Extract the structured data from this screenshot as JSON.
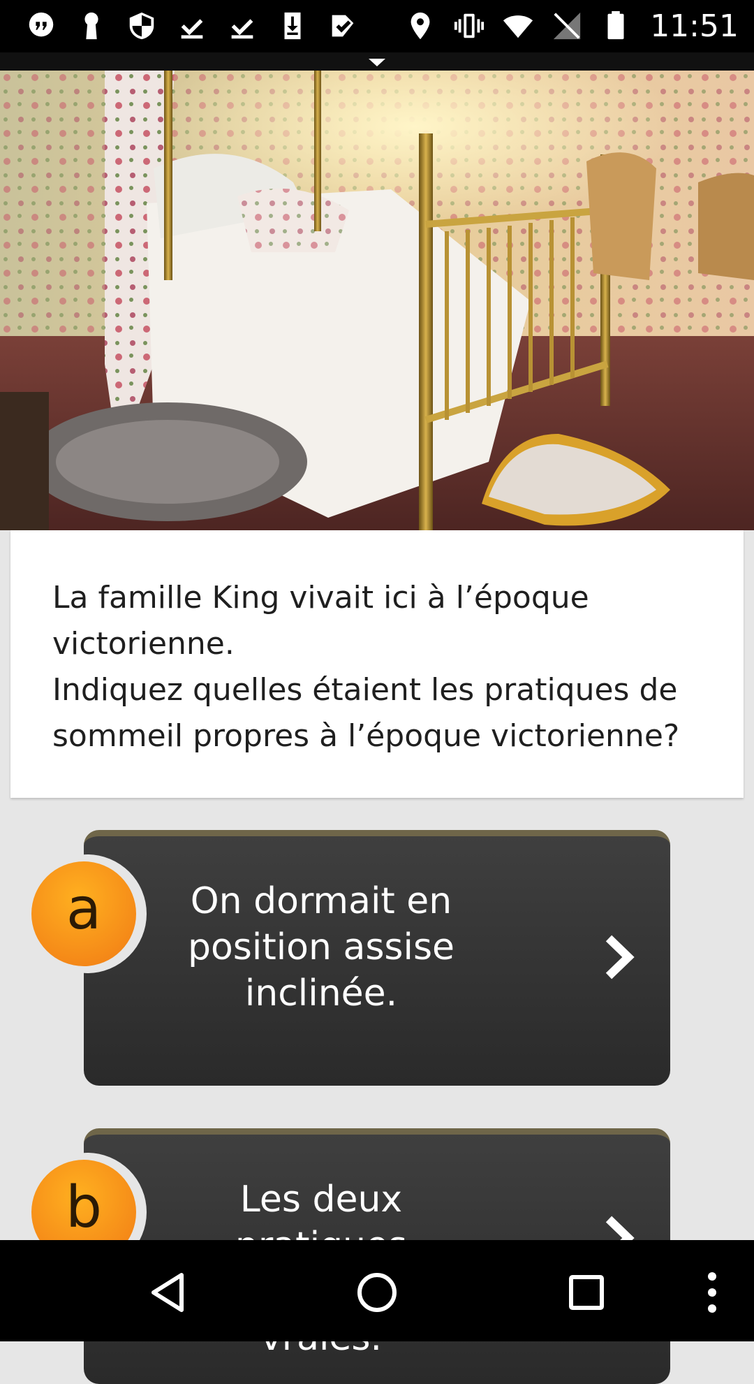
{
  "status_bar": {
    "time": "11:51",
    "left_icons": [
      "quote-icon",
      "keyhole-icon",
      "shield-icon",
      "download-done-icon",
      "download-done-icon",
      "download-icon",
      "task-check-icon"
    ],
    "right_icons": [
      "location-icon",
      "vibrate-icon",
      "wifi-icon",
      "no-signal-icon",
      "battery-icon"
    ]
  },
  "hero": {
    "image": "victorian-bedroom-photo"
  },
  "question": {
    "text": "La famille King  vivait ici à l’époque victorienne.\nIndiquez quelles étaient les pratiques de sommeil propres à l’époque victorienne?"
  },
  "answers": [
    {
      "letter": "a",
      "text": "On dormait en position assise inclinée."
    },
    {
      "letter": "b",
      "text": "Les deux pratiques décrites sont vraies."
    }
  ],
  "nav": {
    "buttons": [
      "back-icon",
      "home-icon",
      "recents-icon",
      "more-icon"
    ]
  },
  "colors": {
    "accent": "#f58a18",
    "answer_bg": "#333333",
    "answer_top_border": "#6f6649",
    "page_bg": "#e6e6e6"
  }
}
